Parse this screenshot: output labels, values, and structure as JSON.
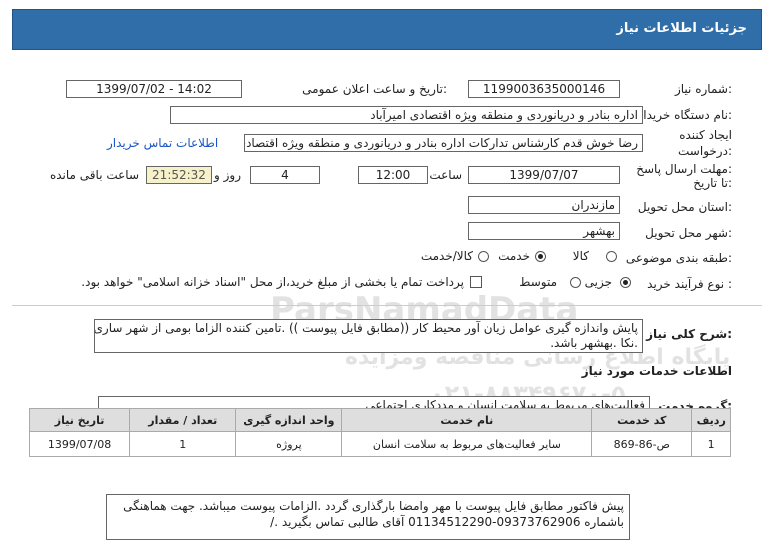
{
  "header": {
    "title": "جزئیات اطلاعات نیاز"
  },
  "fields": {
    "need_number_label": "شماره نیاز:",
    "need_number": "1199003635000146",
    "announce_label": "تاریخ و ساعت اعلان عمومی:",
    "announce_value": "1399/07/02 - 14:02",
    "buyer_label": "نام دستگاه خریدار:",
    "buyer_value": "اداره بنادر و دریانوردی و منطقه ویژه اقتصادی امیرآباد",
    "creator_label_1": "ایجاد کننده",
    "creator_label_2": "درخواست:",
    "creator_value": "رضا خوش قدم کارشناس تدارکات اداره بنادر و دریانوردی و منطقه ویژه اقتصادی ا",
    "contact_link": "اطلاعات تماس خریدار",
    "deadline_label_1": "مهلت ارسال پاسخ:",
    "deadline_label_2": "تا تاریخ:",
    "deadline_date": "1399/07/07",
    "time_label": "ساعت",
    "deadline_time": "12:00",
    "days_value": "4",
    "days_label": "روز و",
    "remaining_time": "21:52:32",
    "remaining_label": "ساعت باقی مانده",
    "province_label": "استان محل تحویل:",
    "province_value": "مازندران",
    "city_label": "شهر محل تحویل:",
    "city_value": "بهشهر",
    "category_label": "طبقه بندی موضوعی:",
    "category_options": [
      "کالا",
      "خدمت",
      "کالا/خدمت"
    ],
    "category_selected": "خدمت",
    "process_label": "نوع فرآیند خرید :",
    "process_options": [
      "جزیی",
      "متوسط"
    ],
    "process_selected": "جزیی",
    "payment_note": "پرداخت تمام یا بخشی از مبلغ خرید،از محل \"اسناد خزانه اسلامی\" خواهد بود."
  },
  "description": {
    "label": "شرح کلی نیاز:",
    "line1": "پایش واندازه گیری عوامل زیان آور محیط کار ((مطابق فایل پیوست )) .تامین کننده الزاما بومی از شهر ساری",
    "line2": ".نکا .بهشهر باشد."
  },
  "services_section": {
    "title": "اطلاعات خدمات مورد نیاز",
    "group_label": "گروه خدمت:",
    "group_value": "فعالیت‌های مربوط به سلامت انسان و مددکاری اجتماعی",
    "columns": [
      "ردیف",
      "کد خدمت",
      "نام خدمت",
      "واحد اندازه گیری",
      "تعداد / مقدار",
      "تاریخ نیاز"
    ],
    "rows": [
      {
        "row": "1",
        "code": "ص-86-869",
        "name": "سایر فعالیت‌های مربوط به سلامت انسان",
        "unit": "پروژه",
        "qty": "1",
        "date": "1399/07/08"
      }
    ]
  },
  "buyer_notes": {
    "line1": "پیش فاکتور مطابق فایل پیوست با مهر وامضا بارگذاری گردد .الزامات پیوست میباشد. جهت هماهنگی",
    "line2": "باشماره 09373762906-01134512290 آقای طالبی تماس بگیرید ./"
  },
  "watermark": {
    "brand": "ParsNamadData",
    "line1": "پایگاه اطلاع رسانی مناقصه ومزایده",
    "line2": "۰۲۱-۸۸۳۴۹۶۷۰-۵"
  }
}
